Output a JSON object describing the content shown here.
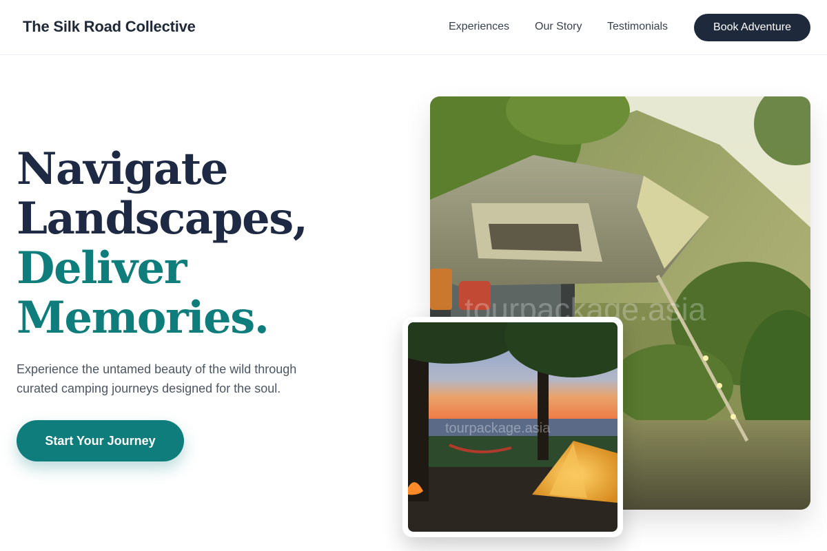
{
  "header": {
    "brand": "The Silk Road Collective",
    "nav": [
      "Experiences",
      "Our Story",
      "Testimonials"
    ],
    "book_button": "Book Adventure"
  },
  "hero": {
    "headline_dark": [
      "Navigate",
      "Landscapes,"
    ],
    "headline_teal": [
      "Deliver",
      "Memories."
    ],
    "subtext": "Experience the untamed beauty of the wild through curated camping journeys designed for the soul.",
    "cta": "Start Your Journey"
  },
  "images": {
    "main_watermark": "tourpackage.asia",
    "small_watermark": "tourpackage.asia"
  },
  "colors": {
    "primary_dark": "#1e293b",
    "accent_teal": "#0f7d7c",
    "body_text": "#4b5563"
  }
}
